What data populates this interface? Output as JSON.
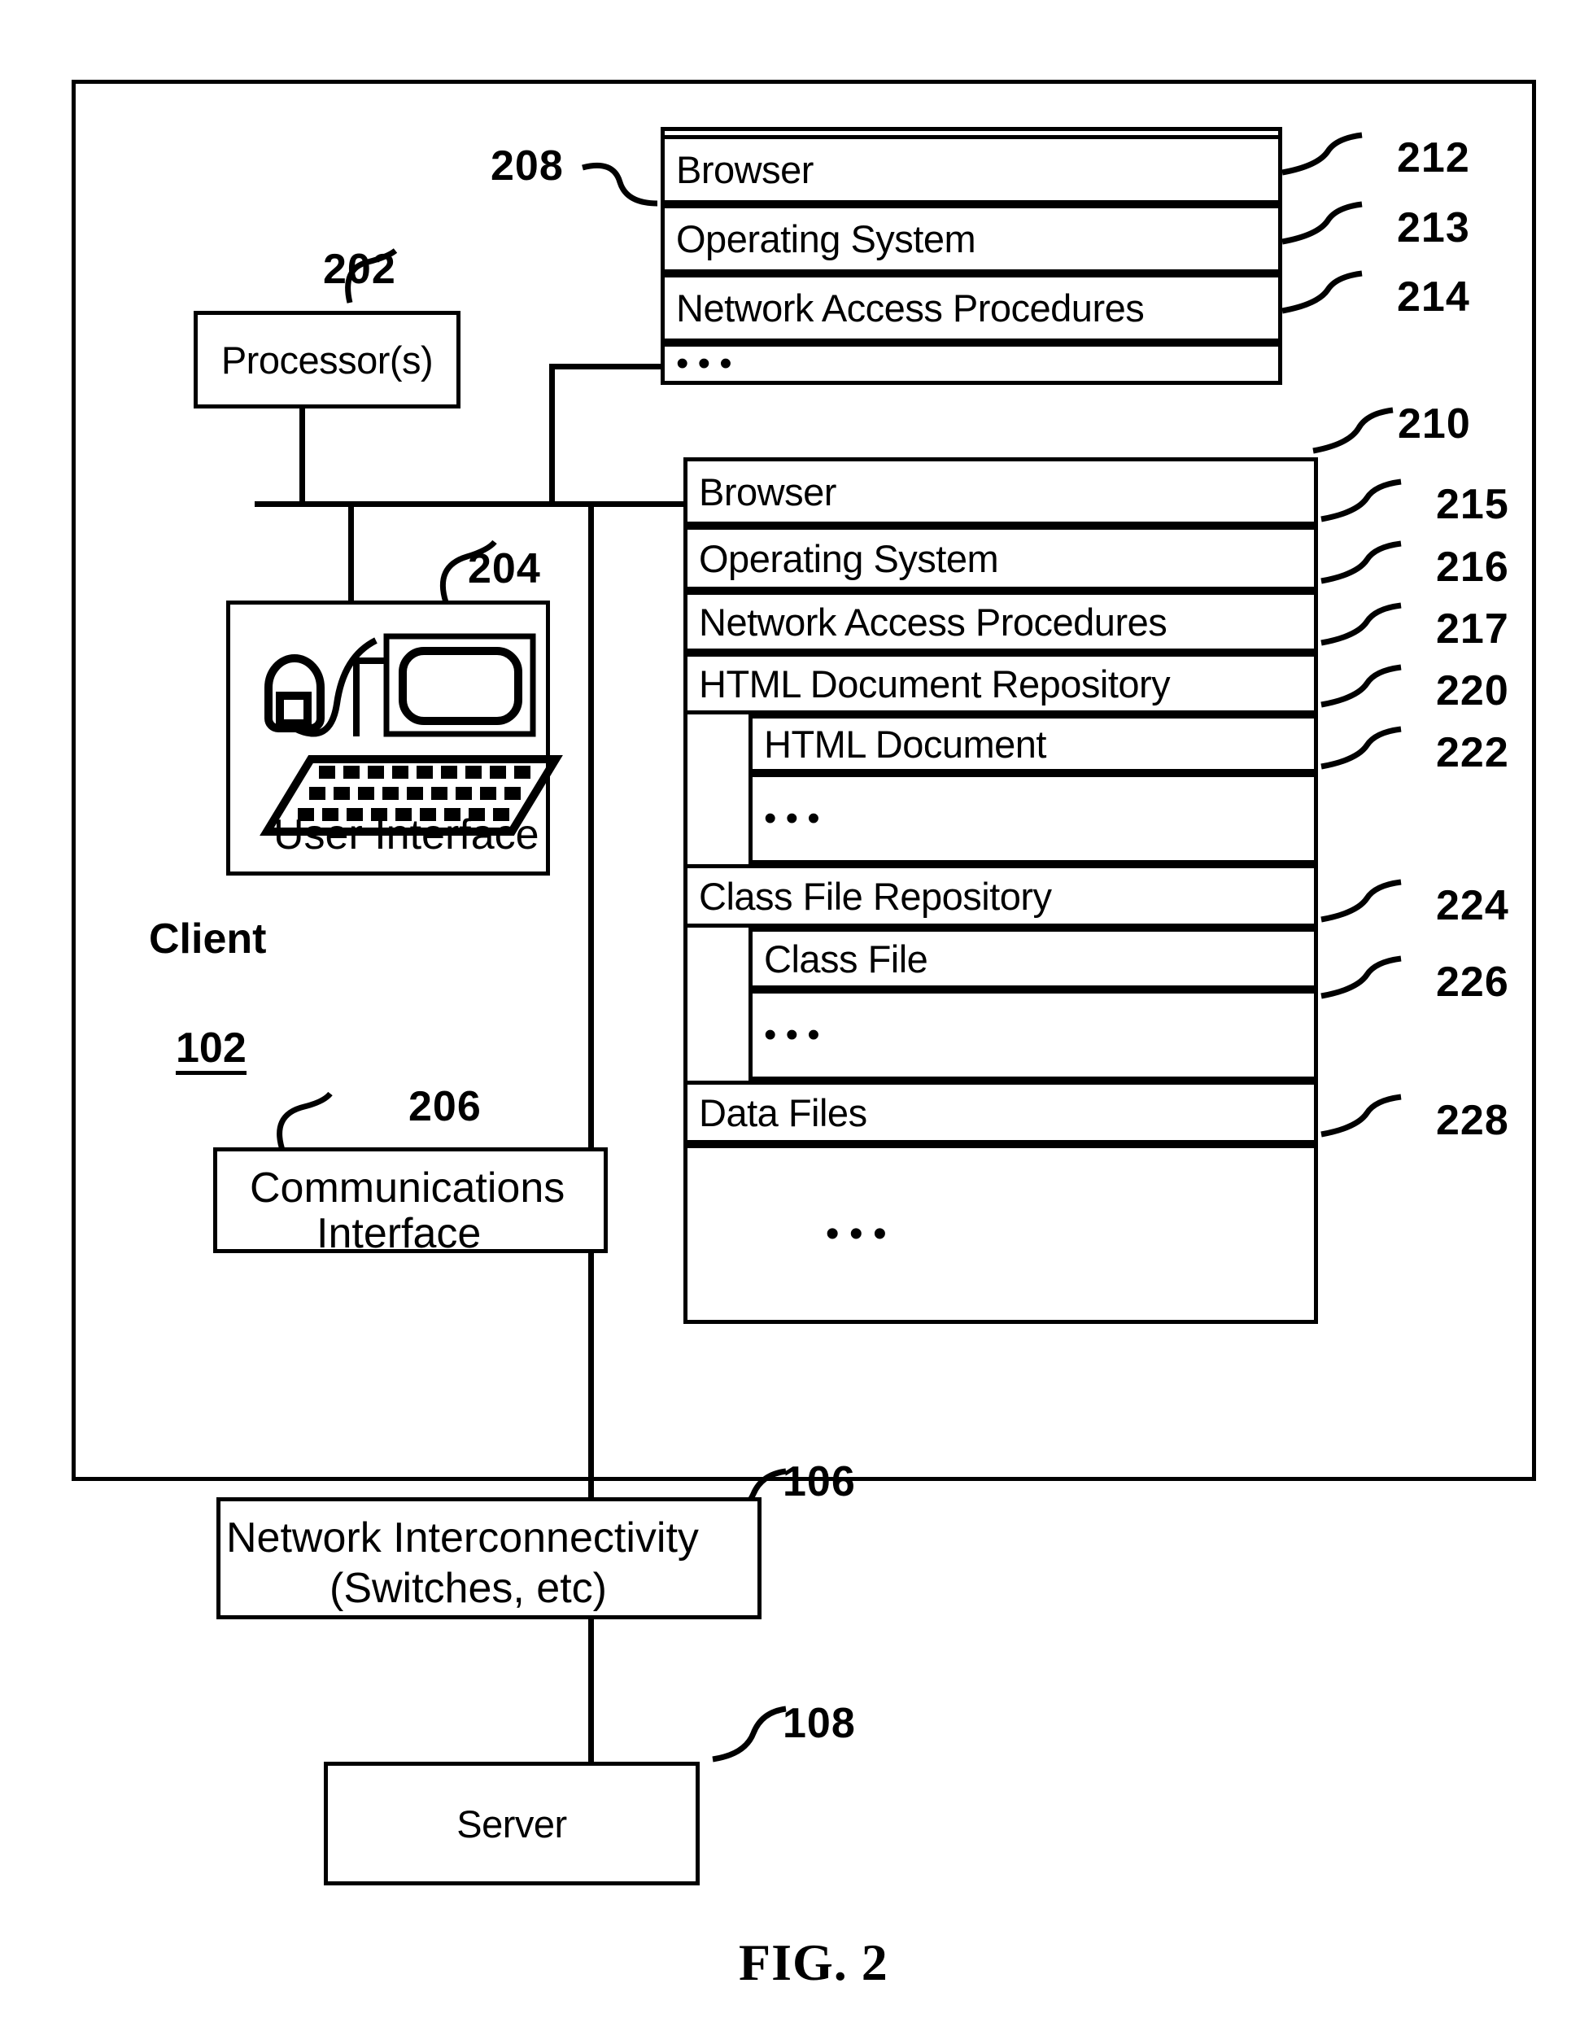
{
  "figure": {
    "caption": "FIG. 2",
    "client": {
      "title": "Client",
      "ref": "102",
      "processor": {
        "label": "Processor(s)",
        "ref": "202"
      },
      "user_interface": {
        "label": "User Interface",
        "ref": "204"
      },
      "communications_interface": {
        "label": "Communications\nInterface",
        "ref": "206"
      },
      "memory_top": {
        "ref": "208",
        "rows": [
          {
            "label": "Browser",
            "ref": "212"
          },
          {
            "label": "Operating System",
            "ref": "213"
          },
          {
            "label": "Network Access Procedures",
            "ref": "214"
          },
          {
            "label": "• • •",
            "ref": ""
          }
        ]
      },
      "memory_main": {
        "ref": "210",
        "rows": [
          {
            "label": "Browser",
            "ref": "215"
          },
          {
            "label": "Operating System",
            "ref": "216"
          },
          {
            "label": "Network Access Procedures",
            "ref": "217"
          },
          {
            "label": "HTML Document Repository",
            "ref": "220"
          },
          {
            "label": "HTML Document",
            "ref": "222"
          },
          {
            "label": "• • •",
            "ref": ""
          },
          {
            "label": "Class File Repository",
            "ref": "224"
          },
          {
            "label": "Class File",
            "ref": "226"
          },
          {
            "label": "• • •",
            "ref": ""
          },
          {
            "label": "Data Files",
            "ref": "228"
          },
          {
            "label": "• • •",
            "ref": ""
          }
        ]
      }
    },
    "network": {
      "line1": "Network Interconnectivity",
      "line2": "(Switches, etc)",
      "ref": "106"
    },
    "server": {
      "label": "Server",
      "ref": "108"
    }
  },
  "icons": {
    "mouse": "mouse-icon",
    "monitor": "monitor-icon",
    "keyboard": "keyboard-icon"
  }
}
